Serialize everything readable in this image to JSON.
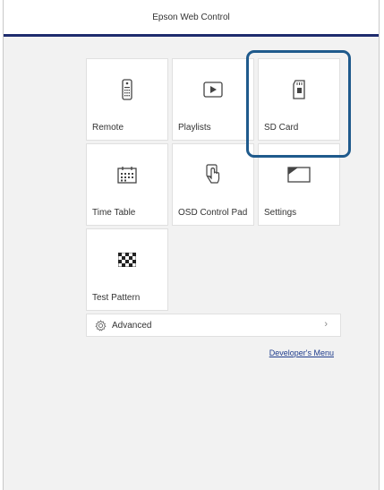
{
  "header": {
    "title": "Epson Web Control"
  },
  "tiles": [
    {
      "label": "Remote",
      "icon": "remote-icon"
    },
    {
      "label": "Playlists",
      "icon": "play-icon"
    },
    {
      "label": "SD Card",
      "icon": "sd-card-icon"
    },
    {
      "label": "Time Table",
      "icon": "calendar-icon"
    },
    {
      "label": "OSD Control Pad",
      "icon": "touch-icon"
    },
    {
      "label": "Settings",
      "icon": "settings-icon"
    },
    {
      "label": "Test Pattern",
      "icon": "checkerboard-icon"
    }
  ],
  "advanced": {
    "label": "Advanced",
    "chevron": "›"
  },
  "developer_link": "Developer's Menu",
  "colors": {
    "accent": "#1f2c6e",
    "highlight": "#1f5a8c",
    "background": "#f2f2f2"
  }
}
